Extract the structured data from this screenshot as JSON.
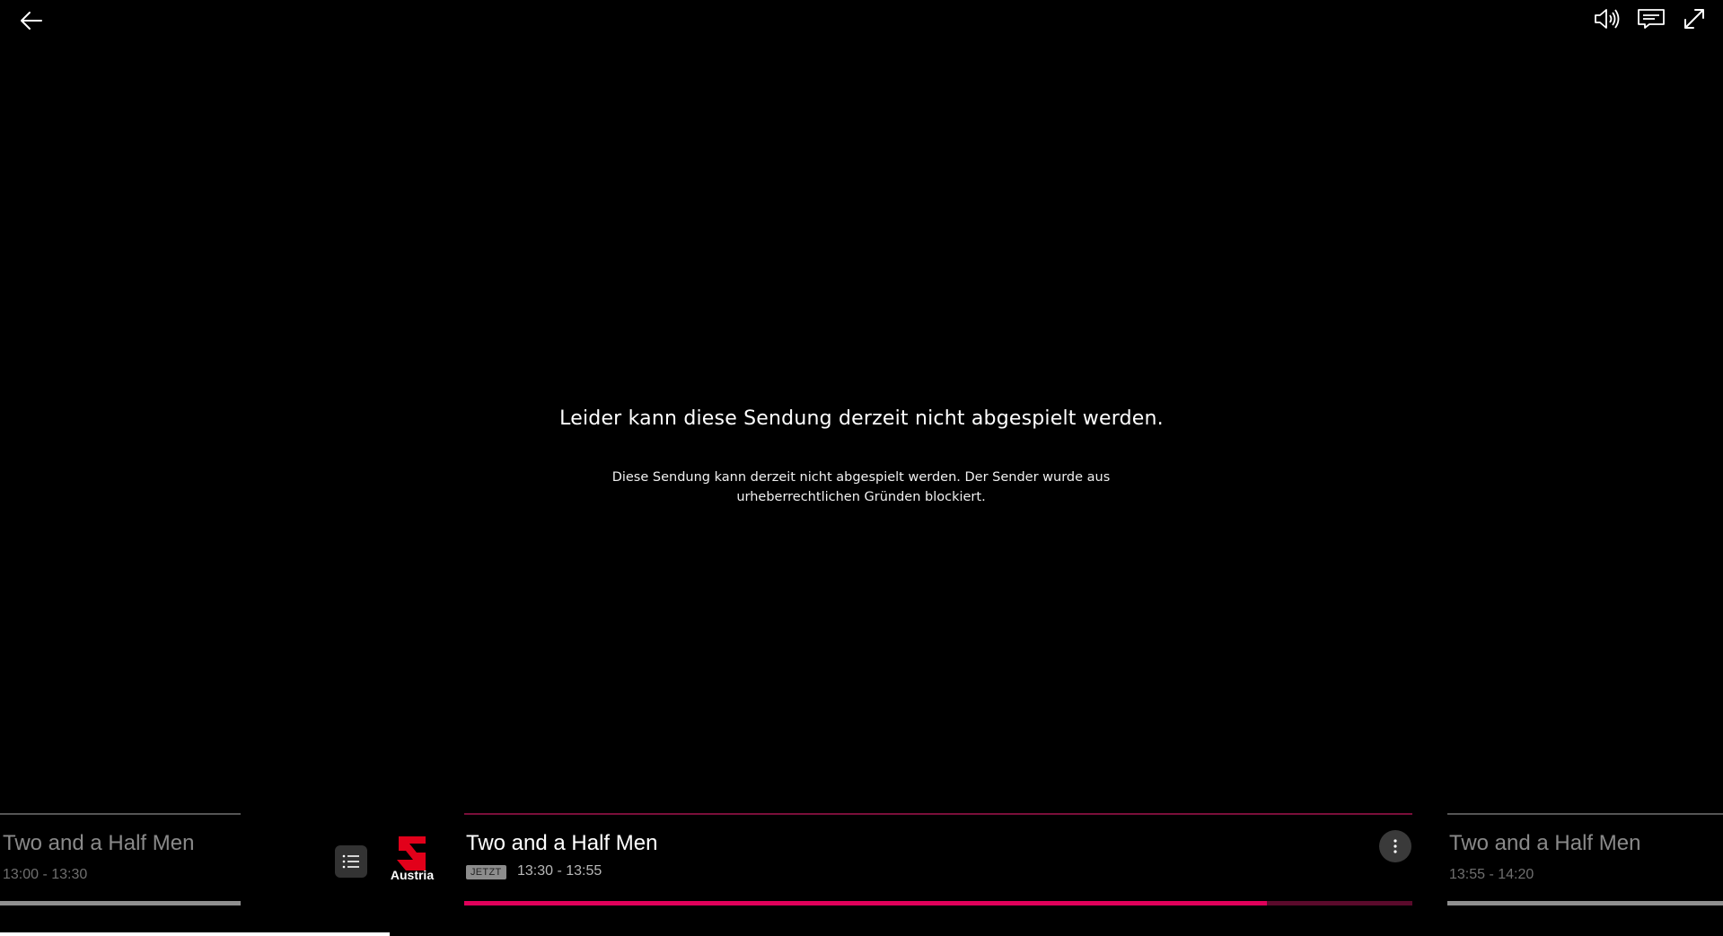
{
  "player": {
    "back_icon": "arrow-left-icon",
    "volume_icon": "speaker-icon",
    "subtitles_icon": "subtitles-icon",
    "fullscreen_icon": "expand-icon"
  },
  "message": {
    "title": "Leider kann diese Sendung derzeit nicht abgespielt werden.",
    "body": "Diese Sendung kann derzeit nicht abgespielt werden. Der Sender wurde aus urheberrechtlichen Gründen blockiert."
  },
  "channel": {
    "logo_label": "Austria",
    "brand_color": "#e2001a"
  },
  "schedule": {
    "previous": {
      "title": "Two and a Half Men",
      "time": "13:00 - 13:30",
      "progress": 1.0
    },
    "current": {
      "title": "Two and a Half Men",
      "badge": "JETZT",
      "time": "13:30 - 13:55",
      "progress": 0.847
    },
    "next": {
      "title": "Two and a Half Men",
      "time": "13:55 - 14:20",
      "progress": 1.0
    }
  },
  "colors": {
    "accent": "#e0005a",
    "accent_dark": "#5a0a2b",
    "background": "#000000"
  }
}
